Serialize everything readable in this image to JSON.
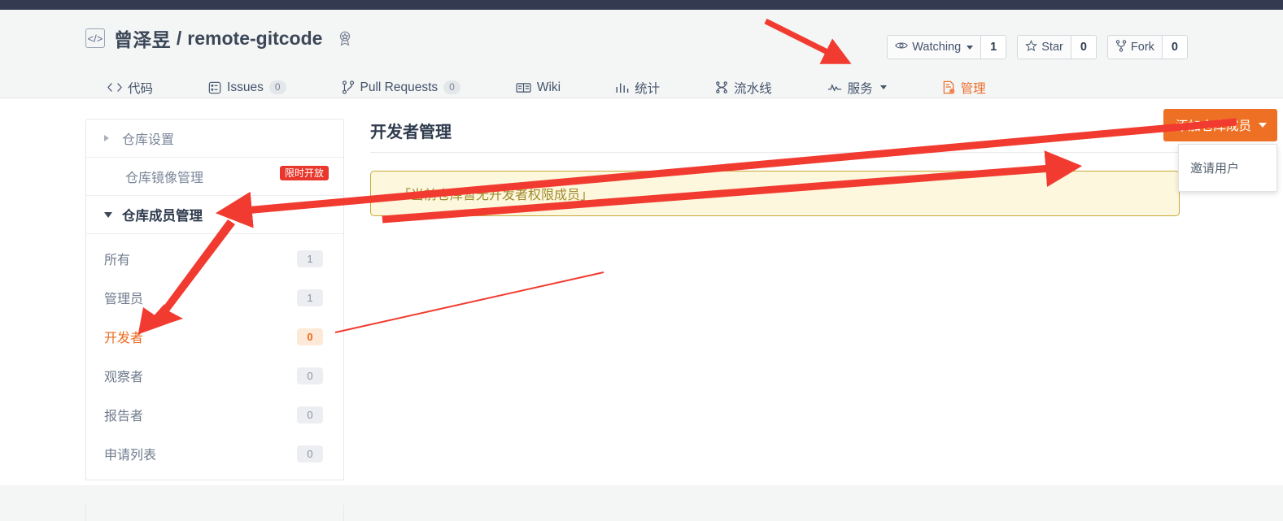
{
  "repo": {
    "icon": "code-brackets-icon",
    "owner": "曾泽昱",
    "separator": "/",
    "name": "remote-gitcode",
    "award_icon": "award-badge-icon"
  },
  "header_actions": {
    "watching": {
      "icon": "eye-icon",
      "label": "Watching",
      "count": "1"
    },
    "star": {
      "icon": "star-icon",
      "label": "Star",
      "count": "0"
    },
    "fork": {
      "icon": "fork-icon",
      "label": "Fork",
      "count": "0"
    }
  },
  "nav_tabs": [
    {
      "icon": "code-icon",
      "label": "代码",
      "count": null,
      "active": false
    },
    {
      "icon": "issues-icon",
      "label": "Issues",
      "count": "0",
      "active": false
    },
    {
      "icon": "pull-request-icon",
      "label": "Pull Requests",
      "count": "0",
      "active": false
    },
    {
      "icon": "wiki-book-icon",
      "label": "Wiki",
      "count": null,
      "active": false
    },
    {
      "icon": "chart-bar-icon",
      "label": "统计",
      "count": null,
      "active": false
    },
    {
      "icon": "pipeline-icon",
      "label": "流水线",
      "count": null,
      "active": false
    },
    {
      "icon": "service-pulse-icon",
      "label": "服务",
      "count": null,
      "active": false,
      "caret": true
    },
    {
      "icon": "manage-doc-icon",
      "label": "管理",
      "count": null,
      "active": true
    }
  ],
  "sidebar": {
    "repo_settings": {
      "label": "仓库设置",
      "icon": "chevron-right-icon"
    },
    "mirror_management": {
      "label": "仓库镜像管理",
      "badge": "限时开放"
    },
    "member_management": {
      "label": "仓库成员管理",
      "icon": "chevron-down-icon"
    },
    "members": [
      {
        "label": "所有",
        "count": "1",
        "active": false
      },
      {
        "label": "管理员",
        "count": "1",
        "active": false
      },
      {
        "label": "开发者",
        "count": "0",
        "active": true
      },
      {
        "label": "观察者",
        "count": "0",
        "active": false
      },
      {
        "label": "报告者",
        "count": "0",
        "active": false
      },
      {
        "label": "申请列表",
        "count": "0",
        "active": false
      }
    ]
  },
  "main": {
    "title": "开发者管理",
    "add_member_button": "添加仓库成员",
    "dropdown_items": [
      {
        "label": "邀请用户"
      }
    ],
    "notice": "「当前仓库暂无开发者权限成员」"
  },
  "colors": {
    "accent_orange": "#ed7024",
    "topbar_navy": "#343a50",
    "notice_bg": "#fcf7dd",
    "notice_border": "#c6a83a",
    "annotation_red": "#f23b30",
    "badge_red": "#e8372c"
  }
}
